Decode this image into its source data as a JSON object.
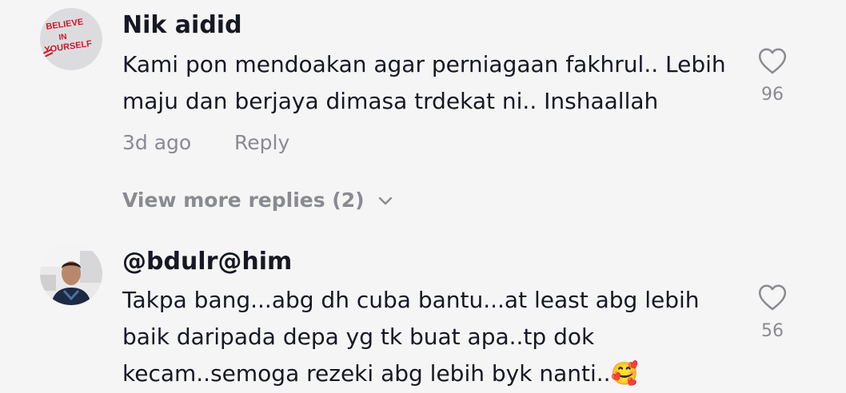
{
  "comments": [
    {
      "author": "Nik aidid",
      "avatar_text": "BELIEVE IN YOURSELF",
      "text": "Kami pon mendoakan agar perniagaan fakhrul.. Lebih maju dan berjaya dimasa trdekat ni.. Inshaallah",
      "time": "3d ago",
      "reply_label": "Reply",
      "likes": "96",
      "view_more": "View more replies (2)"
    },
    {
      "author": "@bdulr@him",
      "text": "Takpa bang...abg dh cuba bantu...at least abg lebih baik daripada depa yg tk buat apa..tp dok kecam..semoga rezeki abg lebih byk nanti..",
      "emoji": "🥰",
      "likes": "56"
    }
  ],
  "icons": {
    "like": "heart-outline-icon",
    "expand": "chevron-down-icon"
  },
  "colors": {
    "background": "#f5f5f5",
    "primary_text": "#161823",
    "secondary_text": "#8a8b91"
  }
}
